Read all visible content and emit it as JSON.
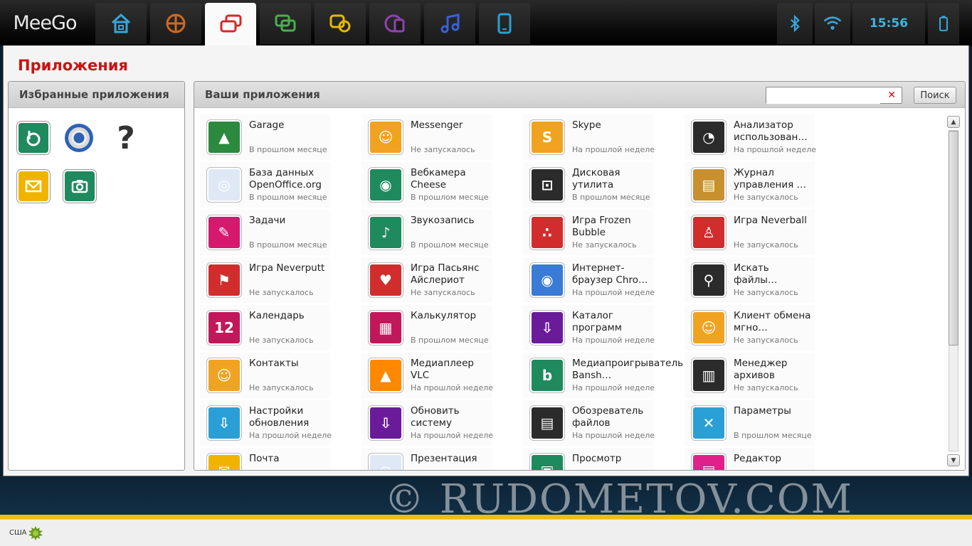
{
  "topbar": {
    "logo": "MeeGo",
    "clock": "15:56",
    "tabs": [
      {
        "name": "home",
        "color": "#3aa5d8"
      },
      {
        "name": "zones",
        "color": "#d2691e"
      },
      {
        "name": "applications",
        "color": "#d62828",
        "active": true
      },
      {
        "name": "status",
        "color": "#4caf50"
      },
      {
        "name": "people",
        "color": "#e6b800"
      },
      {
        "name": "internet",
        "color": "#8e44ad"
      },
      {
        "name": "media",
        "color": "#3a5fd8"
      },
      {
        "name": "devices",
        "color": "#2aa0d0"
      }
    ]
  },
  "window": {
    "title": "Приложения"
  },
  "favorites": {
    "title": "Избранные приложения",
    "items": [
      "banshee",
      "chrome",
      "help",
      "mail",
      "cheese"
    ]
  },
  "apps": {
    "title": "Ваши приложения",
    "search": {
      "value": "",
      "button": "Поиск"
    },
    "columns": [
      [
        {
          "name": "Garage",
          "status": "В прошлом месяце",
          "icon": "garage-icon",
          "color": "#2b8a3e"
        },
        {
          "name": "База данных OpenOffice.org",
          "status": "В прошлом месяце",
          "icon": "database-icon",
          "color": "#dfe9f5"
        },
        {
          "name": "Задачи",
          "status": "В прошлом месяце",
          "icon": "tasks-icon",
          "color": "#d6186f"
        },
        {
          "name": "Игра Neverputt",
          "status": "Не запускалось",
          "icon": "flag-icon",
          "color": "#d12d2d"
        },
        {
          "name": "Календарь",
          "status": "Не запускалось",
          "icon": "calendar-icon",
          "color": "#c2185b"
        },
        {
          "name": "Контакты",
          "status": "Не запускалось",
          "icon": "contacts-icon",
          "color": "#f0a320"
        },
        {
          "name": "Настройки обновления",
          "status": "На прошлой неделе",
          "icon": "update-settings-icon",
          "color": "#2a9fd6"
        },
        {
          "name": "Почта",
          "status": "",
          "icon": "mail-icon",
          "color": "#f0b400"
        }
      ],
      [
        {
          "name": "Messenger",
          "status": "Не запускалось",
          "icon": "messenger-icon",
          "color": "#f0a320"
        },
        {
          "name": "Вебкамера Cheese",
          "status": "В прошлом месяце",
          "icon": "camera-icon",
          "color": "#1e8a5e"
        },
        {
          "name": "Звукозапись",
          "status": "В прошлом месяце",
          "icon": "microphone-icon",
          "color": "#1e8a5e"
        },
        {
          "name": "Игра Пасьянс Айслериот",
          "status": "Не запускалось",
          "icon": "cards-icon",
          "color": "#d12d2d"
        },
        {
          "name": "Калькулятор",
          "status": "В прошлом месяце",
          "icon": "calculator-icon",
          "color": "#c2185b"
        },
        {
          "name": "Медиаплеер VLC",
          "status": "На прошлой неделе",
          "icon": "vlc-icon",
          "color": "#ff8800"
        },
        {
          "name": "Обновить систему",
          "status": "На прошлой неделе",
          "icon": "system-update-icon",
          "color": "#6a1b9a"
        },
        {
          "name": "Презентация",
          "status": "",
          "icon": "presentation-icon",
          "color": "#dfe9f5"
        }
      ],
      [
        {
          "name": "Skype",
          "status": "На прошлой неделе",
          "icon": "skype-icon",
          "color": "#f0a320"
        },
        {
          "name": "Дисковая утилита",
          "status": "В прошлом месяце",
          "icon": "disk-utility-icon",
          "color": "#2b2b2b"
        },
        {
          "name": "Игра Frozen Bubble",
          "status": "Не запускалось",
          "icon": "bubble-icon",
          "color": "#d12d2d"
        },
        {
          "name": "Интернет-браузер Chro…",
          "status": "На прошлой неделе",
          "icon": "chrome-icon",
          "color": "#3a7bd5"
        },
        {
          "name": "Каталог программ",
          "status": "На прошлой неделе",
          "icon": "catalog-icon",
          "color": "#6a1b9a"
        },
        {
          "name": "Медиапроигрыватель Bansh…",
          "status": "На прошлой неделе",
          "icon": "banshee-icon",
          "color": "#1e8a5e"
        },
        {
          "name": "Обозреватель файлов",
          "status": "На прошлой неделе",
          "icon": "file-browser-icon",
          "color": "#2b2b2b"
        },
        {
          "name": "Просмотр",
          "status": "",
          "icon": "viewer-icon",
          "color": "#1e8a5e"
        }
      ],
      [
        {
          "name": "Анализатор использован…",
          "status": "На прошлой неделе",
          "icon": "disk-usage-icon",
          "color": "#2b2b2b"
        },
        {
          "name": "Журнал управления …",
          "status": "Не запускалось",
          "icon": "log-icon",
          "color": "#c8902e"
        },
        {
          "name": "Игра Neverball",
          "status": "Не запускалось",
          "icon": "neverball-icon",
          "color": "#d12d2d"
        },
        {
          "name": "Искать файлы…",
          "status": "Не запускалось",
          "icon": "search-files-icon",
          "color": "#2b2b2b"
        },
        {
          "name": "Клиент обмена мгно…",
          "status": "Не запускалось",
          "icon": "im-client-icon",
          "color": "#f0a320"
        },
        {
          "name": "Менеджер архивов",
          "status": "Не запускалось",
          "icon": "archive-icon",
          "color": "#2b2b2b"
        },
        {
          "name": "Параметры",
          "status": "В прошлом месяце",
          "icon": "settings-icon",
          "color": "#2a9fd6"
        },
        {
          "name": "Редактор",
          "status": "",
          "icon": "editor-icon",
          "color": "#e0218a"
        }
      ]
    ]
  },
  "wallpaper": {
    "watermark": "© RUDOMETOV.COM"
  },
  "statusbar": {
    "layout": "США"
  }
}
